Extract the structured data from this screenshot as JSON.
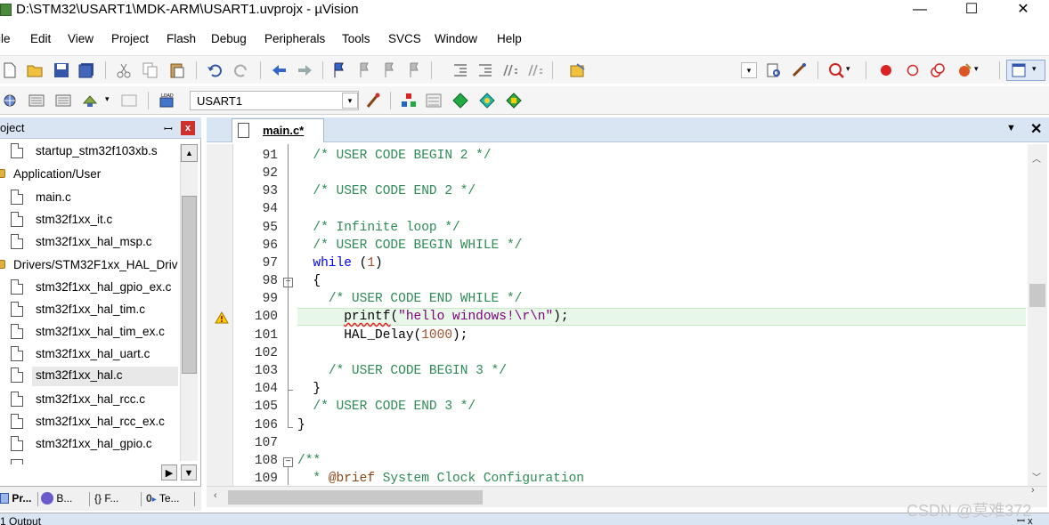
{
  "window": {
    "title": "D:\\STM32\\USART1\\MDK-ARM\\USART1.uvprojx - µVision",
    "minimize": "—",
    "maximize": "☐",
    "close": "✕"
  },
  "menu": [
    "ile",
    "Edit",
    "View",
    "Project",
    "Flash",
    "Debug",
    "Peripherals",
    "Tools",
    "SVCS",
    "Window",
    "Help"
  ],
  "toolbar2": {
    "target": "USART1"
  },
  "project_panel": {
    "title": "oject",
    "pin": "ꟷ",
    "close": "x",
    "items": [
      {
        "label": "startup_stm32f103xb.s",
        "type": "file"
      },
      {
        "label": "Application/User",
        "type": "folder"
      },
      {
        "label": "main.c",
        "type": "file"
      },
      {
        "label": "stm32f1xx_it.c",
        "type": "file"
      },
      {
        "label": "stm32f1xx_hal_msp.c",
        "type": "file"
      },
      {
        "label": "Drivers/STM32F1xx_HAL_Driv",
        "type": "folder"
      },
      {
        "label": "stm32f1xx_hal_gpio_ex.c",
        "type": "file"
      },
      {
        "label": "stm32f1xx_hal_tim.c",
        "type": "file"
      },
      {
        "label": "stm32f1xx_hal_tim_ex.c",
        "type": "file"
      },
      {
        "label": "stm32f1xx_hal_uart.c",
        "type": "file"
      },
      {
        "label": "stm32f1xx_hal.c",
        "type": "file",
        "selected": true
      },
      {
        "label": "stm32f1xx_hal_rcc.c",
        "type": "file"
      },
      {
        "label": "stm32f1xx_hal_rcc_ex.c",
        "type": "file"
      },
      {
        "label": "stm32f1xx_hal_gpio.c",
        "type": "file"
      }
    ],
    "tabs": [
      {
        "label": "Pr..."
      },
      {
        "label": "B..."
      },
      {
        "label": "{} F..."
      },
      {
        "label": "Te..."
      }
    ]
  },
  "editor": {
    "tab_label": "main.c*",
    "tab_menu": "▼",
    "tab_close": "✕",
    "line_numbers": [
      "91",
      "92",
      "93",
      "94",
      "95",
      "96",
      "97",
      "98",
      "99",
      "100",
      "101",
      "102",
      "103",
      "104",
      "105",
      "106",
      "107",
      "108",
      "109"
    ],
    "current_line": "100"
  },
  "output": {
    "label": "1 Output",
    "pin": "ꟷ x"
  },
  "watermark": "CSDN @莫难372",
  "colors": {
    "comment": "#2e8b57",
    "keyword": "#0000ff",
    "number": "#a0522d",
    "string": "#800080",
    "current_line_bg": "#e8f8e8",
    "panel_header": "#d9e5f3"
  }
}
